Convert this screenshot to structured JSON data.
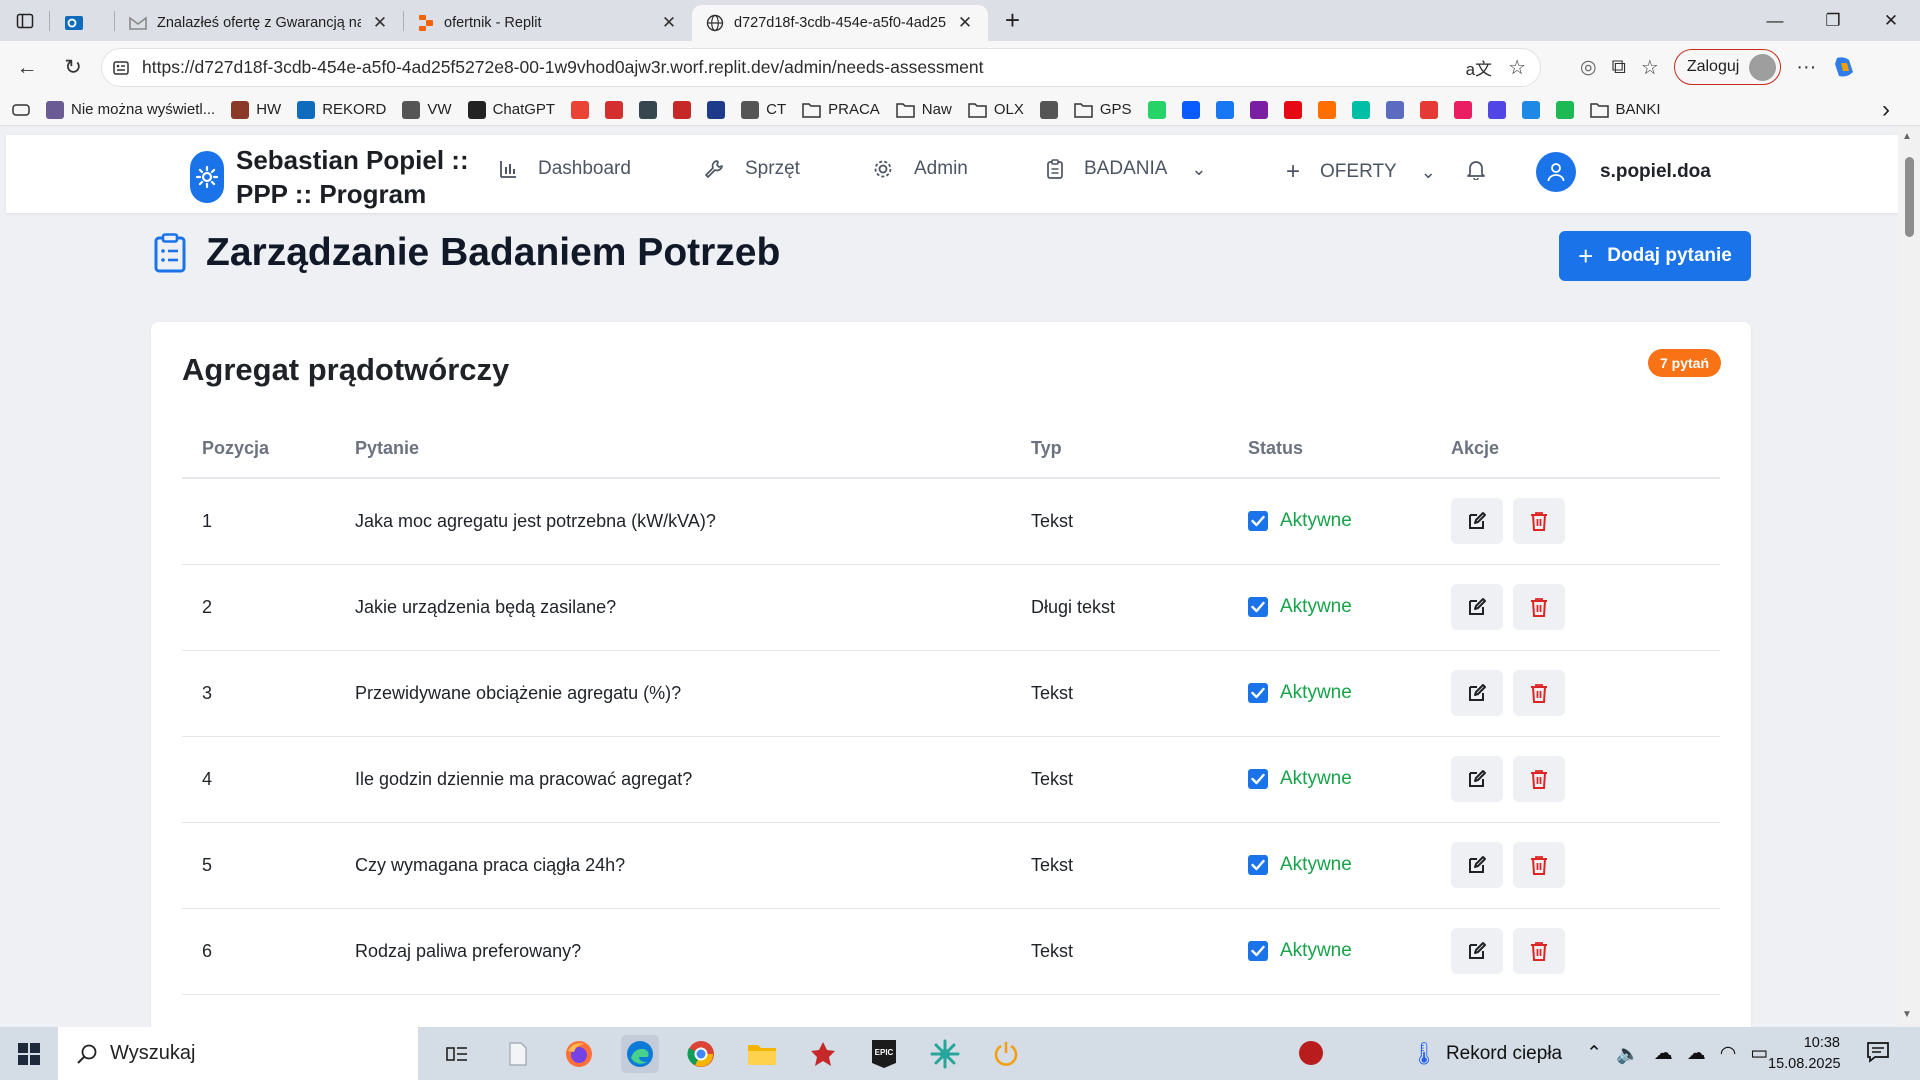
{
  "browser": {
    "tabs": [
      {
        "title": "",
        "icon": "outlook-icon",
        "active": false
      },
      {
        "title": "Znalazłeś ofertę z Gwarancją najn",
        "icon": "gmail-icon",
        "active": false
      },
      {
        "title": "ofertnik - Replit",
        "icon": "replit-icon",
        "active": false
      },
      {
        "title": "d727d18f-3cdb-454e-a5f0-4ad25",
        "icon": "globe-icon",
        "active": true
      }
    ],
    "url": "https://d727d18f-3cdb-454e-a5f0-4ad25f5272e8-00-1w9vhod0ajw3r.worf.replit.dev/admin/needs-assessment",
    "login_label": "Zaloguj",
    "bookmarks": [
      {
        "label": "Nie można wyświetl...",
        "color": "#6b5b95"
      },
      {
        "label": "HW",
        "color": "#8b3a2a"
      },
      {
        "label": "REKORD",
        "color": "#0f6cbd"
      },
      {
        "label": "VW",
        "color": "#555555"
      },
      {
        "label": "ChatGPT",
        "color": "#222222"
      },
      {
        "label": "",
        "color": "#ea4335"
      },
      {
        "label": "",
        "color": "#d32f2f"
      },
      {
        "label": "",
        "color": "#37474f"
      },
      {
        "label": "",
        "color": "#c62828"
      },
      {
        "label": "",
        "color": "#1e3a8a"
      },
      {
        "label": "CT",
        "color": "#555555"
      },
      {
        "label": "PRACA",
        "color": "folder"
      },
      {
        "label": "Naw",
        "color": "folder"
      },
      {
        "label": "OLX",
        "color": "folder"
      },
      {
        "label": "",
        "color": "#555555"
      },
      {
        "label": "GPS",
        "color": "folder"
      },
      {
        "label": "",
        "color": "#25d366"
      },
      {
        "label": "",
        "color": "#0b5cff"
      },
      {
        "label": "",
        "color": "#1877f2"
      },
      {
        "label": "",
        "color": "#7a1fa2"
      },
      {
        "label": "",
        "color": "#e50914"
      },
      {
        "label": "",
        "color": "#ff6f00"
      },
      {
        "label": "",
        "color": "#00bfa5"
      },
      {
        "label": "",
        "color": "#5c6bc0"
      },
      {
        "label": "",
        "color": "#e53935"
      },
      {
        "label": "",
        "color": "#e91e63"
      },
      {
        "label": "",
        "color": "#4f46e5"
      },
      {
        "label": "",
        "color": "#1e88e5"
      },
      {
        "label": "",
        "color": "#1db954"
      },
      {
        "label": "BANKI",
        "color": "folder"
      }
    ]
  },
  "app": {
    "brand_line1": "Sebastian Popiel ::",
    "brand_line2": "PPP :: Program",
    "nav": {
      "dashboard": "Dashboard",
      "sprzet": "Sprzęt",
      "admin": "Admin",
      "badania": "BADANIA",
      "oferty": "OFERTY"
    },
    "user": "s.popiel.doa",
    "page_title": "Zarządzanie Badaniem Potrzeb",
    "add_button": "Dodaj pytanie",
    "section_title": "Agregat prądotwórczy",
    "count_badge": "7 pytań",
    "table": {
      "headers": [
        "Pozycja",
        "Pytanie",
        "Typ",
        "Status",
        "Akcje"
      ],
      "rows": [
        {
          "pos": "1",
          "question": "Jaka moc agregatu jest potrzebna (kW/kVA)?",
          "type": "Tekst",
          "status": "Aktywne"
        },
        {
          "pos": "2",
          "question": "Jakie urządzenia będą zasilane?",
          "type": "Długi tekst",
          "status": "Aktywne"
        },
        {
          "pos": "3",
          "question": "Przewidywane obciążenie agregatu (%)?",
          "type": "Tekst",
          "status": "Aktywne"
        },
        {
          "pos": "4",
          "question": "Ile godzin dziennie ma pracować agregat?",
          "type": "Tekst",
          "status": "Aktywne"
        },
        {
          "pos": "5",
          "question": "Czy wymagana praca ciągła 24h?",
          "type": "Tekst",
          "status": "Aktywne"
        },
        {
          "pos": "6",
          "question": "Rodzaj paliwa preferowany?",
          "type": "Tekst",
          "status": "Aktywne"
        }
      ]
    }
  },
  "taskbar": {
    "search_placeholder": "Wyszukaj",
    "weather": "Rekord ciepła",
    "time": "10:38",
    "date": "15.08.2025"
  },
  "colors": {
    "accent": "#1a73e8",
    "status_active": "#16a34a",
    "badge": "#f97316",
    "delete": "#dc2626"
  }
}
